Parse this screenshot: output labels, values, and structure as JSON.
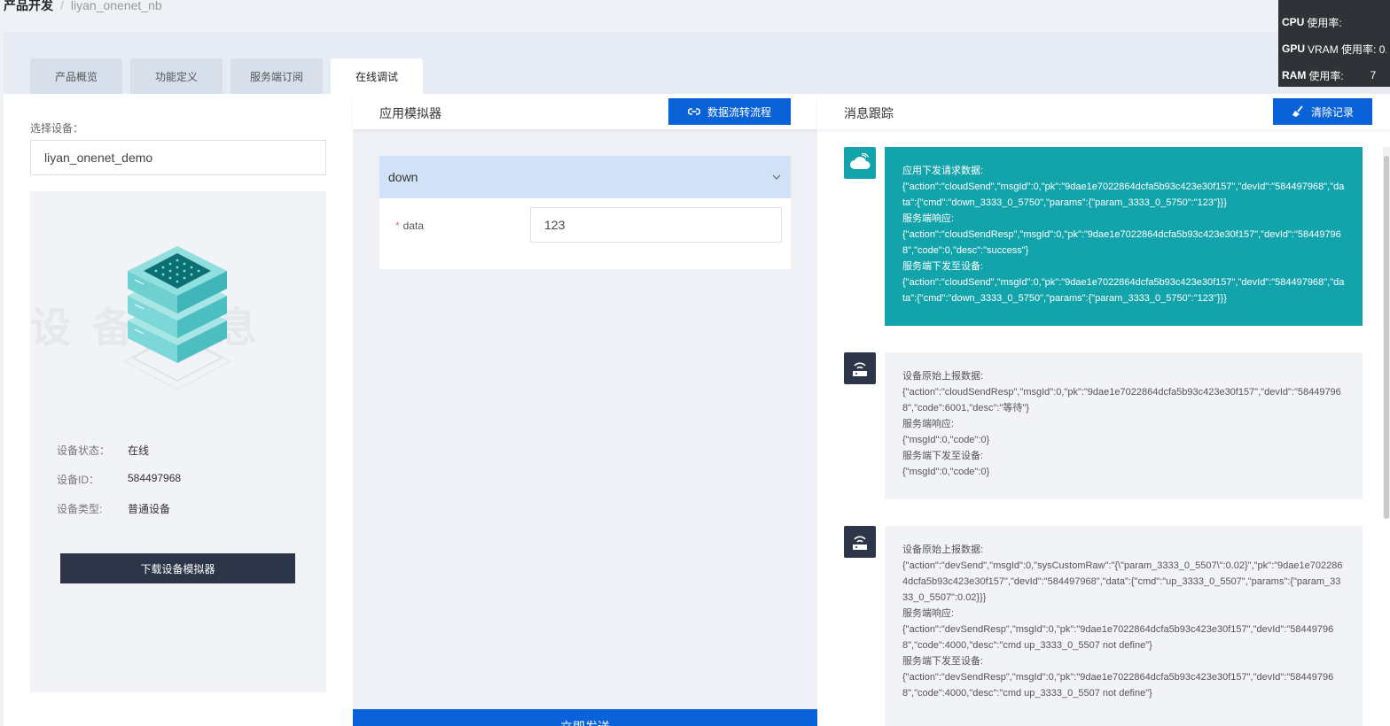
{
  "breadcrumb": {
    "item1": "产品开发",
    "sep": "/",
    "item2": "liyan_onenet_nb"
  },
  "tabs": [
    {
      "label": "产品概览"
    },
    {
      "label": "功能定义"
    },
    {
      "label": "服务端订阅"
    },
    {
      "label": "在线调试"
    }
  ],
  "active_tab": "在线调试",
  "sys_overlay": {
    "cpu_label": "CPU",
    "cpu_suffix": "使用率:",
    "gpu_label": "GPU",
    "gpu_suffix": "VRAM 使用率: 0.",
    "ram_label": "RAM",
    "ram_suffix": "使用率:",
    "ram_value": "7"
  },
  "left": {
    "select_label": "选择设备：",
    "selected_device": "liyan_onenet_demo",
    "watermark": "设备信息",
    "status_label": "设备状态：",
    "status_value": "在线",
    "id_label": "设备ID：",
    "id_value": "584497968",
    "type_label": "设备类型:",
    "type_value": "普通设备",
    "download_button": "下载设备模拟器"
  },
  "middle": {
    "title": "应用模拟器",
    "flow_button": "数据流转流程",
    "collapse_title": "down",
    "field_label": "data",
    "field_value": "123",
    "send_button": "立即发送"
  },
  "right": {
    "title": "消息跟踪",
    "clear_button": "清除记录",
    "messages": [
      {
        "kind": "cloud",
        "lines": [
          "应用下发请求数据:",
          "{\"action\":\"cloudSend\",\"msgId\":0,\"pk\":\"9dae1e7022864dcfa5b93c423e30f157\",\"devId\":\"584497968\",\"data\":{\"cmd\":\"down_3333_0_5750\",\"params\":{\"param_3333_0_5750\":\"123\"}}}",
          "服务端响应:",
          "{\"action\":\"cloudSendResp\",\"msgId\":0,\"pk\":\"9dae1e7022864dcfa5b93c423e30f157\",\"devId\":\"584497968\",\"code\":0,\"desc\":\"success\"}",
          "服务端下发至设备:",
          "{\"action\":\"cloudSend\",\"msgId\":0,\"pk\":\"9dae1e7022864dcfa5b93c423e30f157\",\"devId\":\"584497968\",\"data\":{\"cmd\":\"down_3333_0_5750\",\"params\":{\"param_3333_0_5750\":\"123\"}}}"
        ]
      },
      {
        "kind": "device",
        "lines": [
          "设备原始上报数据:",
          "{\"action\":\"cloudSendResp\",\"msgId\":0,\"pk\":\"9dae1e7022864dcfa5b93c423e30f157\",\"devId\":\"584497968\",\"code\":6001,\"desc\":\"等待\"}",
          "服务端响应:",
          "{\"msgId\":0,\"code\":0}",
          "服务端下发至设备:",
          "{\"msgId\":0,\"code\":0}"
        ]
      },
      {
        "kind": "device",
        "lines": [
          "设备原始上报数据:",
          "{\"action\":\"devSend\",\"msgId\":0,\"sysCustomRaw\":\"{\\\"param_3333_0_5507\\\":0.02}\",\"pk\":\"9dae1e7022864dcfa5b93c423e30f157\",\"devId\":\"584497968\",\"data\":{\"cmd\":\"up_3333_0_5507\",\"params\":{\"param_3333_0_5507\":0.02}}}",
          "服务端响应:",
          "{\"action\":\"devSendResp\",\"msgId\":0,\"pk\":\"9dae1e7022864dcfa5b93c423e30f157\",\"devId\":\"584497968\",\"code\":4000,\"desc\":\"cmd up_3333_0_5507 not define\"}",
          "服务端下发至设备:",
          "{\"action\":\"devSendResp\",\"msgId\":0,\"pk\":\"9dae1e7022864dcfa5b93c423e30f157\",\"devId\":\"584497968\",\"code\":4000,\"desc\":\"cmd up_3333_0_5507 not define\"}"
        ]
      }
    ]
  },
  "colors": {
    "primary": "#0a62d8",
    "cloud_msg": "#13a4ab",
    "dark": "#2d3548"
  }
}
